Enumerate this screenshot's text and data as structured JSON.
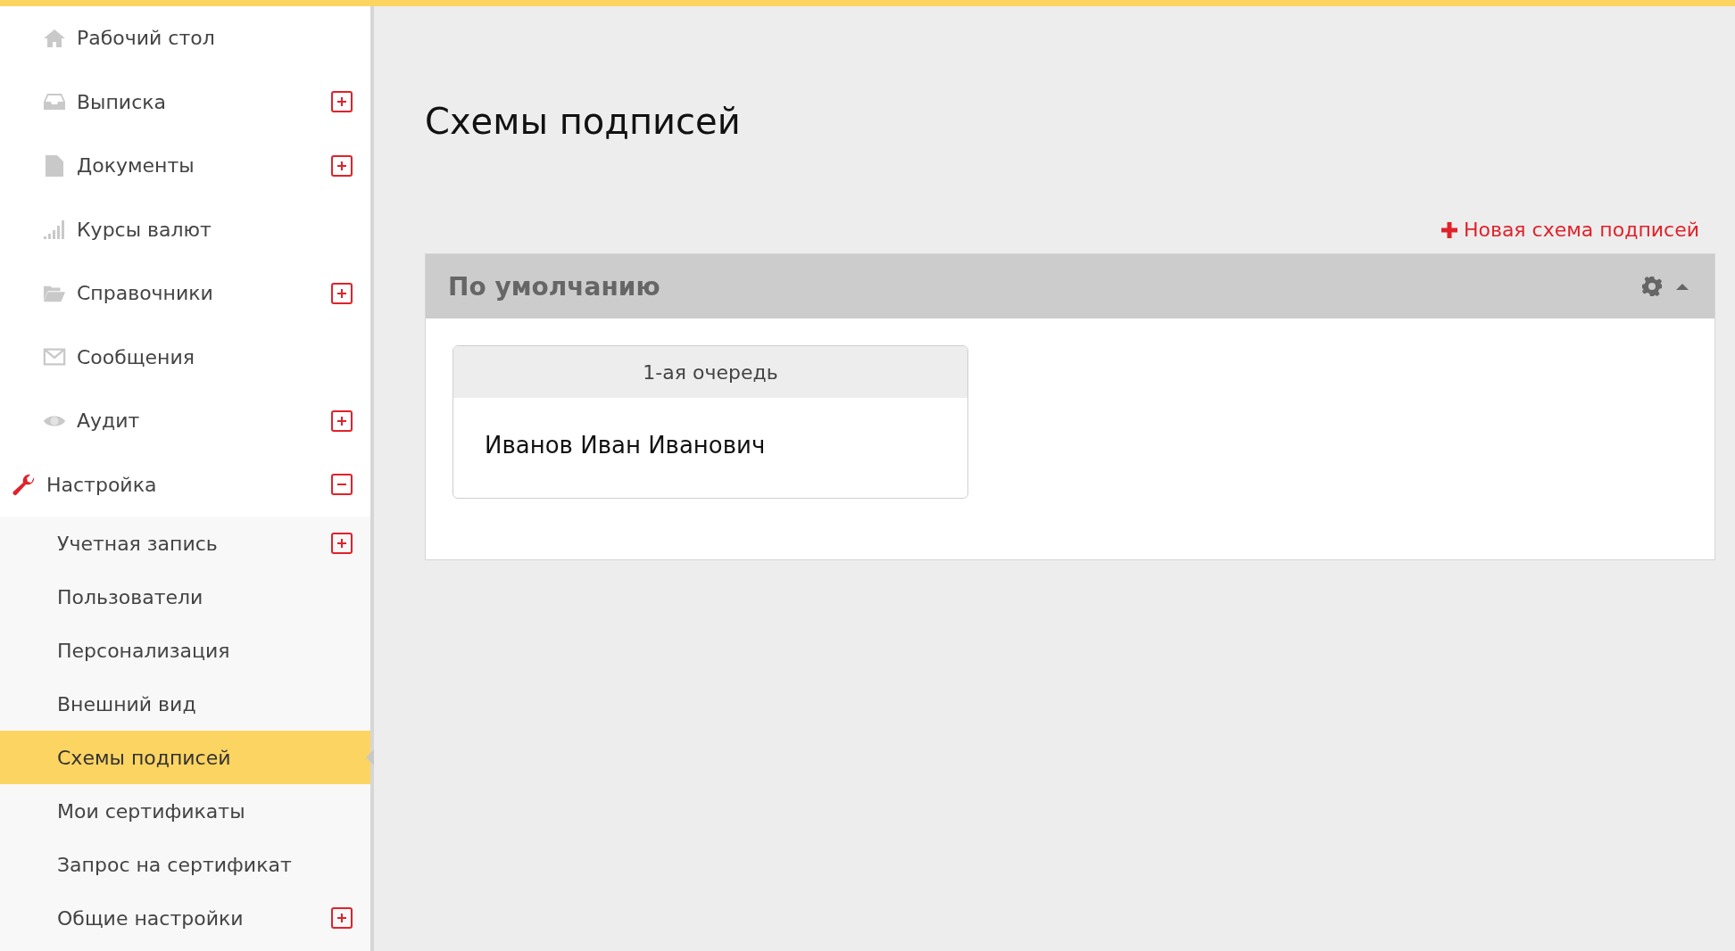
{
  "sidebar": {
    "items": [
      {
        "label": "Рабочий стол",
        "selected": false
      },
      {
        "label": "Выписка",
        "selected": false,
        "expanded": false
      },
      {
        "label": "Документы",
        "selected": false,
        "expanded": false
      },
      {
        "label": "Курсы валют",
        "selected": false
      },
      {
        "label": "Справочники",
        "selected": false,
        "expanded": false
      },
      {
        "label": "Сообщения",
        "selected": false
      },
      {
        "label": "Аудит",
        "selected": false,
        "expanded": false
      },
      {
        "label": "Настройка",
        "selected": false,
        "expanded": true,
        "children": [
          {
            "label": "Учетная запись",
            "selected": false,
            "expanded": false
          },
          {
            "label": "Пользователи",
            "selected": false
          },
          {
            "label": "Персонализация",
            "selected": false
          },
          {
            "label": "Внешний вид",
            "selected": false
          },
          {
            "label": "Схемы подписей",
            "selected": true
          },
          {
            "label": "Мои сертификаты",
            "selected": false
          },
          {
            "label": "Запрос на сертификат",
            "selected": false
          },
          {
            "label": "Общие настройки",
            "selected": false,
            "expanded": false
          }
        ]
      }
    ]
  },
  "page": {
    "title": "Схемы подписей",
    "new_link": "Новая схема подписей",
    "schemes": [
      {
        "title": "По умолчанию",
        "expanded": true,
        "queues": [
          {
            "title": "1-ая очередь",
            "signers": [
              "Иванов Иван Иванович"
            ]
          }
        ]
      }
    ]
  }
}
